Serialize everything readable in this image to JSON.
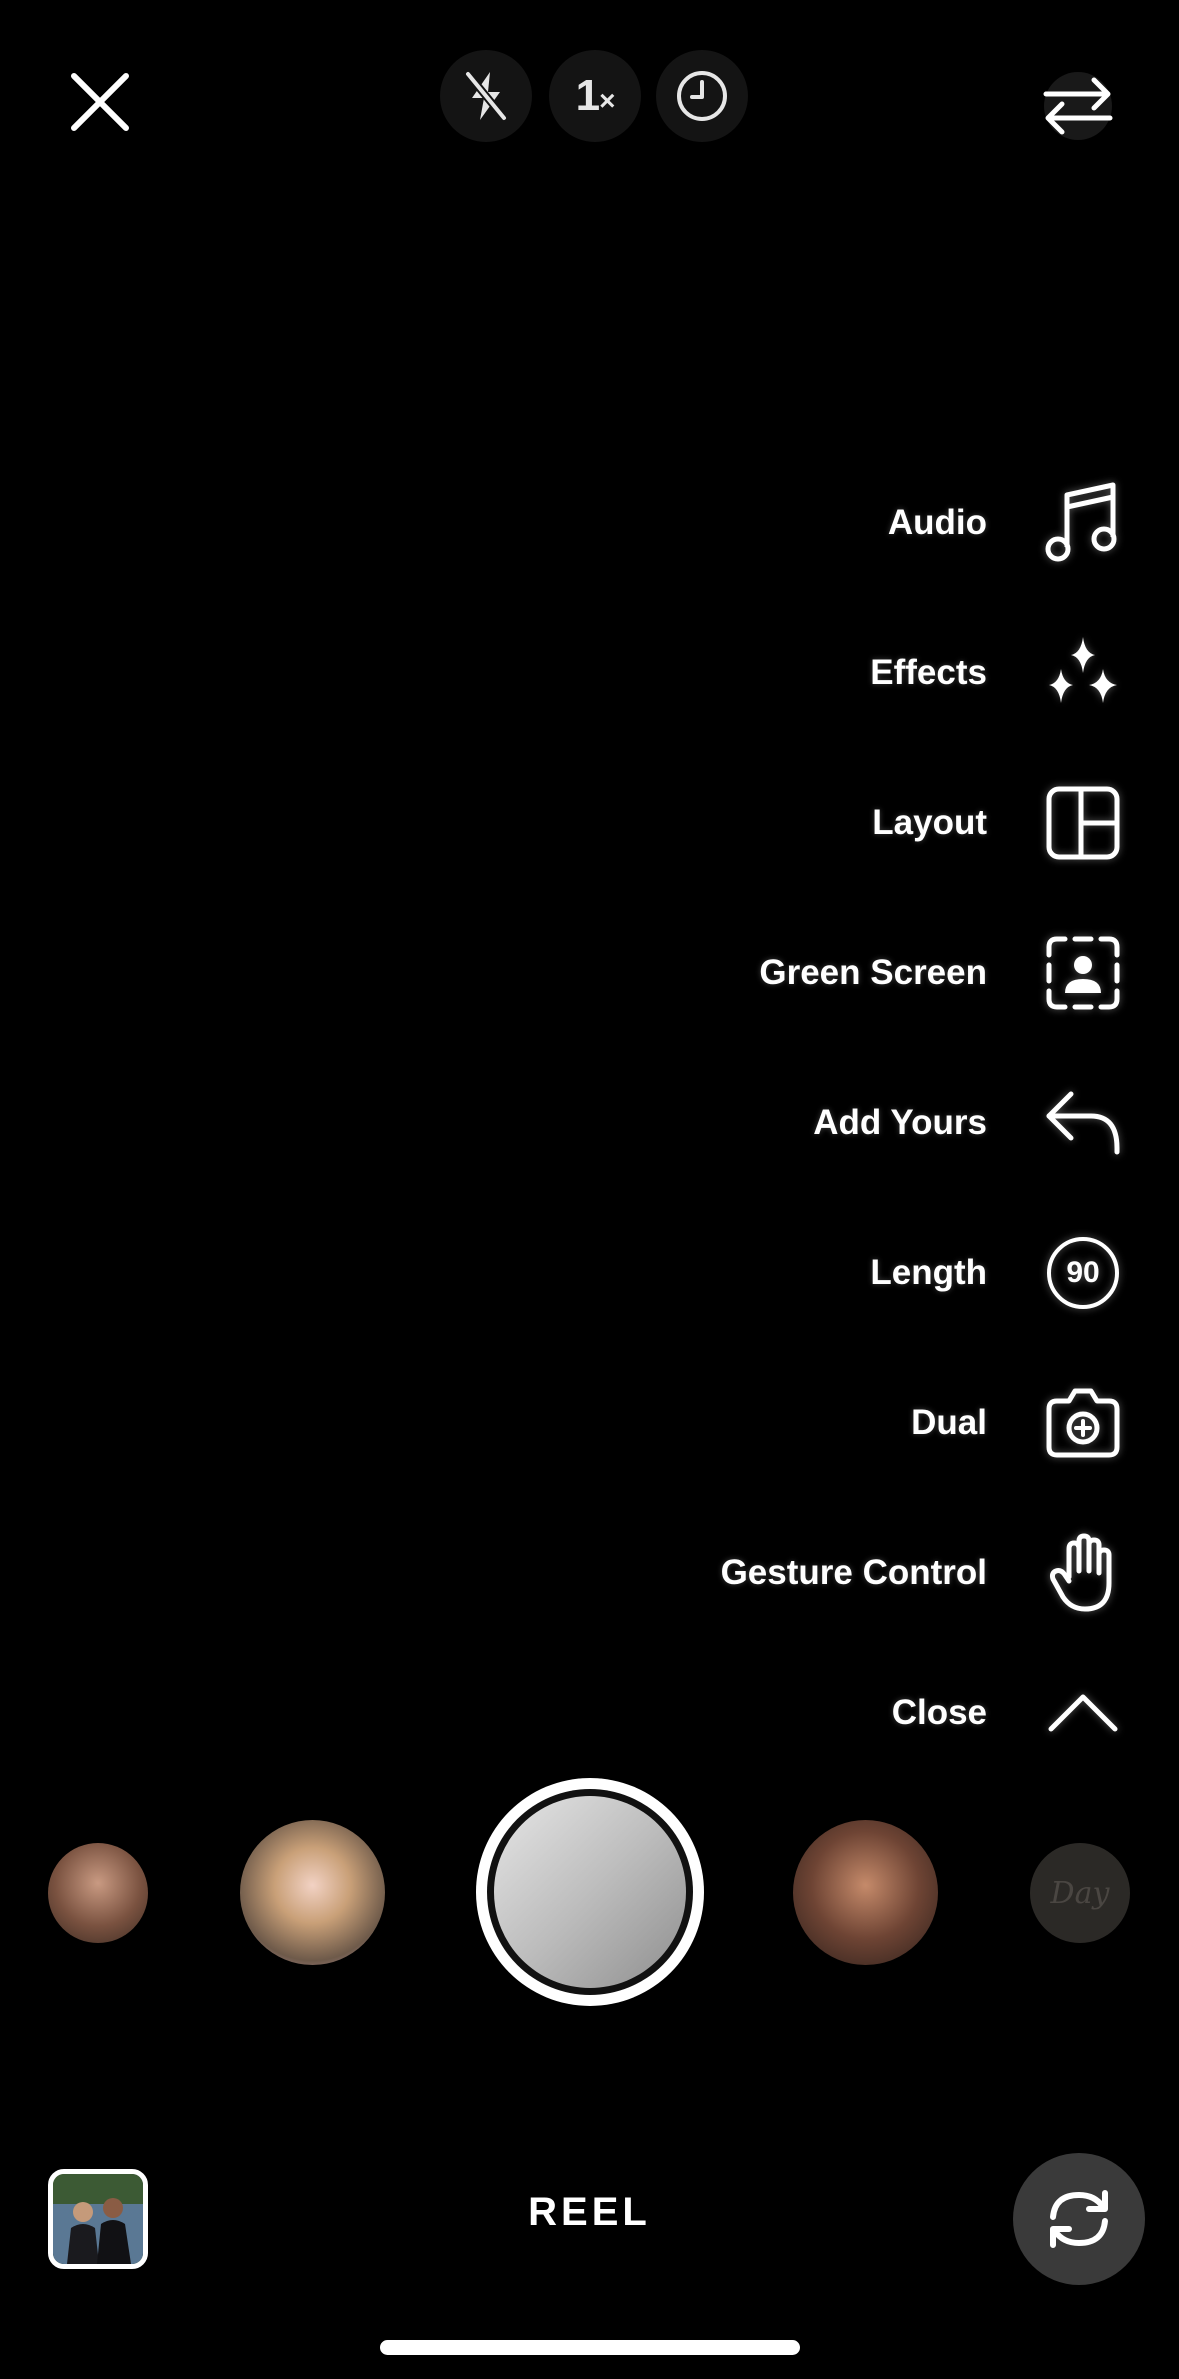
{
  "top_bar": {
    "zoom_value": "1",
    "zoom_suffix": "×",
    "icons": [
      "close-icon",
      "flash-off-icon",
      "timer-icon",
      "switch-camera-icon"
    ]
  },
  "side_menu": {
    "items": [
      {
        "label": "Audio",
        "icon": "music-note-icon"
      },
      {
        "label": "Effects",
        "icon": "sparkles-icon"
      },
      {
        "label": "Layout",
        "icon": "layout-grid-icon"
      },
      {
        "label": "Green Screen",
        "icon": "green-screen-icon"
      },
      {
        "label": "Add Yours",
        "icon": "reply-arrow-icon"
      },
      {
        "label": "Length",
        "icon": "length-timer-icon",
        "value": "90"
      },
      {
        "label": "Dual",
        "icon": "dual-camera-icon"
      },
      {
        "label": "Gesture Control",
        "icon": "hand-icon"
      },
      {
        "label": "Close",
        "icon": "chevron-up-icon"
      }
    ]
  },
  "effects_carousel": {
    "last_effect_text": "Day"
  },
  "bottom_bar": {
    "mode_label": "REEL"
  },
  "colors": {
    "background": "#000000",
    "pill_background": "#141414",
    "flip_button_background": "#3a3a3a",
    "text": "#ffffff"
  }
}
